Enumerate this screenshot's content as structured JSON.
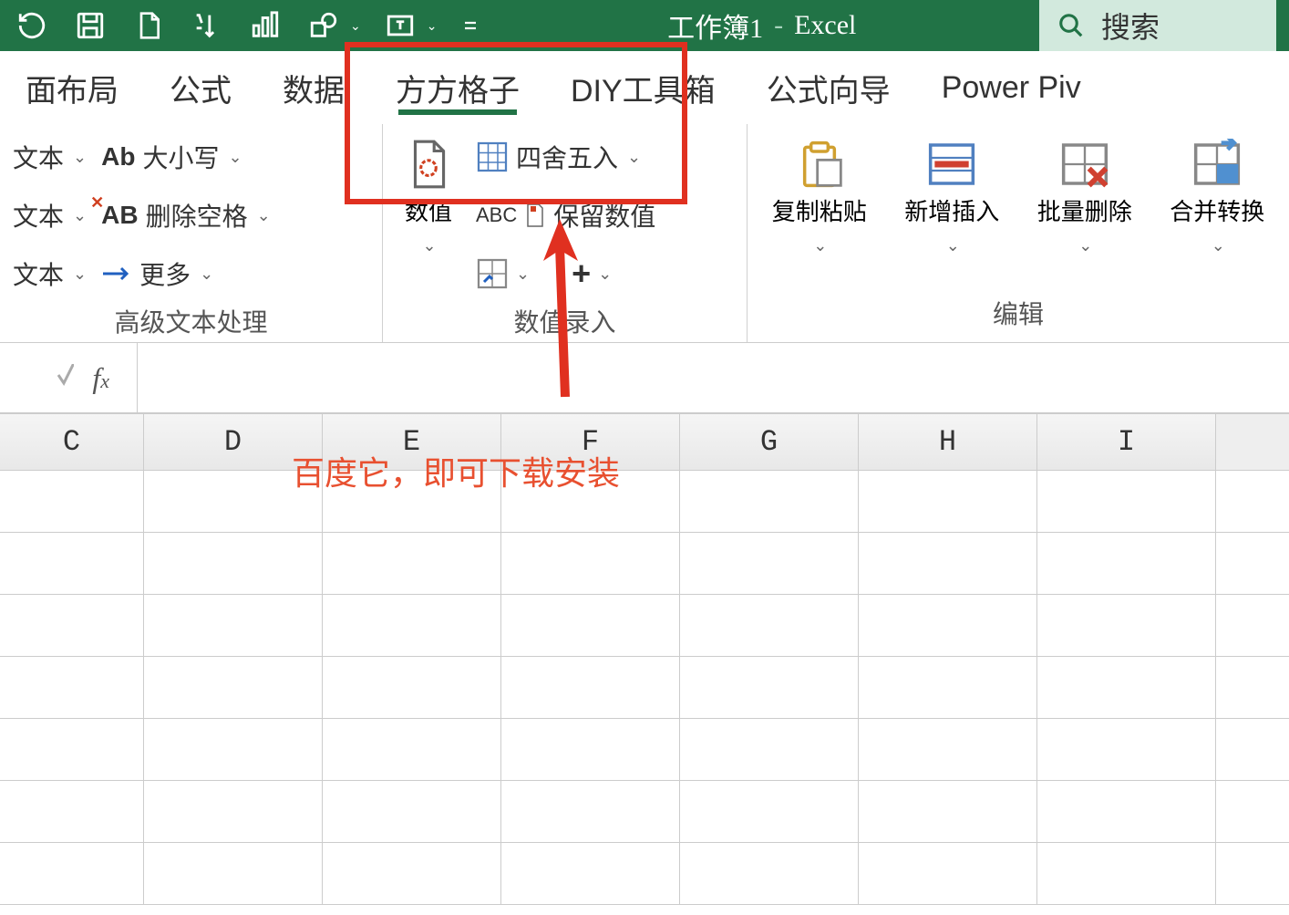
{
  "title": {
    "workbook": "工作簿1",
    "app": "Excel",
    "sep": "-"
  },
  "search": {
    "label": "搜索"
  },
  "tabs": {
    "layout": "面布局",
    "formula": "公式",
    "data": "数据",
    "fangfang": "方方格子",
    "diy": "DIY工具箱",
    "formula_wizard": "公式向导",
    "powerpivot": "Power Piv"
  },
  "ribbon": {
    "group1": {
      "label": "高级文本处理",
      "text1": "文本",
      "case": "大小写",
      "text2": "文本",
      "remove_space": "删除空格",
      "text3": "文本",
      "more": "更多"
    },
    "group2": {
      "label": "数值录入",
      "numeric": "数值",
      "round": "四舍五入",
      "keep_value": "保留数值",
      "abc": "ABC"
    },
    "group3": {
      "label": "编辑",
      "copy_paste": "复制粘贴",
      "new_insert": "新增插入",
      "batch_delete": "批量删除",
      "merge_convert": "合并转换"
    }
  },
  "formula_bar": {
    "fx": "fx"
  },
  "columns": [
    "C",
    "D",
    "E",
    "F",
    "G",
    "H",
    "I"
  ],
  "annotation": {
    "text": "百度它，即可下载安装"
  }
}
